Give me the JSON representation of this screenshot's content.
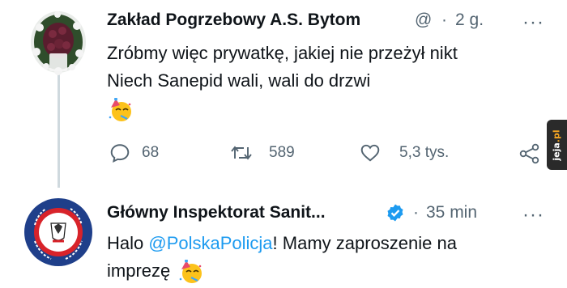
{
  "colors": {
    "accent": "#1d9bf0",
    "text": "#0f1419",
    "secondary": "#536471",
    "thread_line": "#cfd9de",
    "badge_bg": "#2a2a2a",
    "badge_accent": "#f5a623"
  },
  "tweet1": {
    "author_name": "Zakład Pogrzebowy A.S. Bytom",
    "handle": "@",
    "sep": "·",
    "time": "2 g.",
    "more_label": "···",
    "avatar_icon": "funeral-wreath-icon",
    "lines": [
      "Zróbmy więc prywatkę, jakiej nie przeżył nikt",
      "Niech Sanepid wali, wali do drzwi"
    ],
    "emoji_icon": "partying-face-emoji",
    "actions": {
      "reply_count": "68",
      "retweet_count": "589",
      "like_count": "5,3 tys."
    }
  },
  "tweet2": {
    "author_name": "Główny Inspektorat Sanit...",
    "sep": "·",
    "time": "35 min",
    "more_label": "···",
    "avatar_icon": "sanitary-inspection-emblem-icon",
    "verified_icon": "verified-badge-icon",
    "line1_before": "Halo ",
    "mention": "@PolskaPolicja",
    "line1_after": "! Mamy zaproszenie na",
    "line2": "imprezę",
    "emoji_icon": "partying-face-emoji"
  },
  "watermark": {
    "text_main": "jeja",
    "text_accent": ".pl"
  }
}
